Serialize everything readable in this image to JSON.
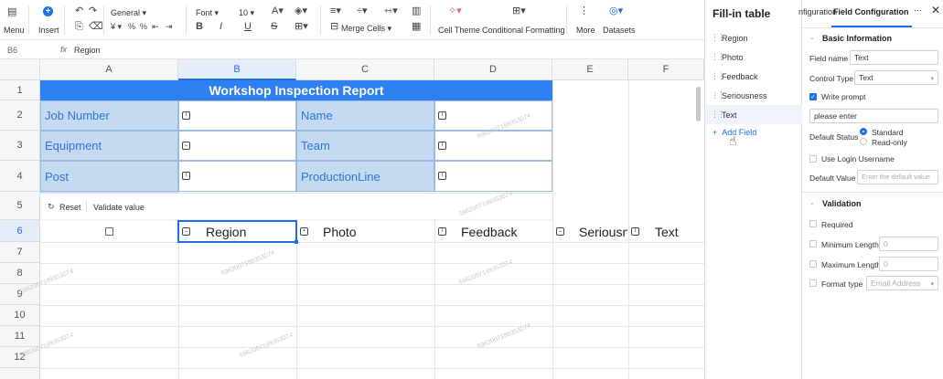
{
  "toolbar": {
    "menu": "Menu",
    "insert": "Insert",
    "number_format": "General",
    "font": "Font",
    "font_size": "10",
    "merge_cells": "Merge Cells",
    "cell_theme": "Cell Theme",
    "conditional_formatting": "Conditional Formatting",
    "more": "More",
    "datasets": "Datasets"
  },
  "formula_bar": {
    "cell_ref": "B6",
    "fx": "fx",
    "value": "Region"
  },
  "grid": {
    "columns": [
      "A",
      "B",
      "C",
      "D",
      "E",
      "F"
    ],
    "rows": [
      "1",
      "2",
      "3",
      "4",
      "5",
      "6",
      "7",
      "8",
      "9",
      "10",
      "11",
      "12"
    ],
    "title": "Workshop Inspection Report",
    "left_labels": [
      "Job Number",
      "Equipment",
      "Post"
    ],
    "right_labels": [
      "Name",
      "Team",
      "ProductionLine"
    ],
    "reset": "Reset",
    "validate": "Validate value",
    "row6": [
      "Region",
      "Photo",
      "Feedback",
      "Seriousn",
      "Text"
    ],
    "watermark": "5962007189353074"
  },
  "field_panel": {
    "title": "Fill-in table",
    "fields": [
      "Region",
      "Photo",
      "Feedback",
      "Seriousness",
      "Text"
    ],
    "add_field": "Add Field"
  },
  "config_panel": {
    "tab_partial": "nfiguration",
    "tab_active": "Field Configuration",
    "basic_info": "Basic Information",
    "field_name_label": "Field name",
    "field_name_value": "Text",
    "control_type_label": "Control Type",
    "control_type_value": "Text",
    "write_prompt": "Write prompt",
    "prompt_value": "please enter",
    "default_status_label": "Default Status",
    "status_standard": "Standard",
    "status_readonly": "Read-only",
    "use_login": "Use Login Username",
    "default_value_label": "Default Value",
    "default_value_placeholder": "Enter the default value",
    "validation": "Validation",
    "required": "Required",
    "min_length": "Minimum Length",
    "max_length": "Maximum Length",
    "zero": "0",
    "format_type": "Format type",
    "format_value": "Email Address"
  },
  "colors": {
    "accent": "#1e6fe6",
    "title_blue": "#2e80f0",
    "label_cell": "#c5d9f1",
    "label_text": "#2e74d6"
  }
}
